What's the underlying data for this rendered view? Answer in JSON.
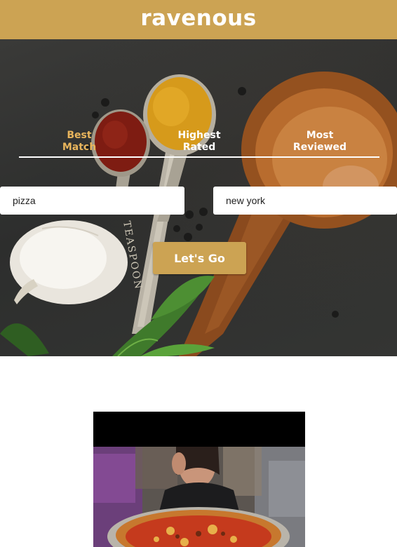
{
  "header": {
    "brand": "ravenous"
  },
  "sort_tabs": [
    {
      "label": "Best\nMatch",
      "active": true
    },
    {
      "label": "Highest\nRated",
      "active": false
    },
    {
      "label": "Most\nReviewed",
      "active": false
    }
  ],
  "search": {
    "term_value": "pizza",
    "location_value": "new york",
    "submit_label": "Let's Go"
  },
  "hero": {
    "image": "spices-wooden-spoon-garlic-photo",
    "spoon_engraving": "TEASPOON"
  },
  "result_card": {
    "image": "woman-with-pizza-photo"
  },
  "colors": {
    "brand": "#cca353",
    "active_tab": "#e9b55c"
  }
}
